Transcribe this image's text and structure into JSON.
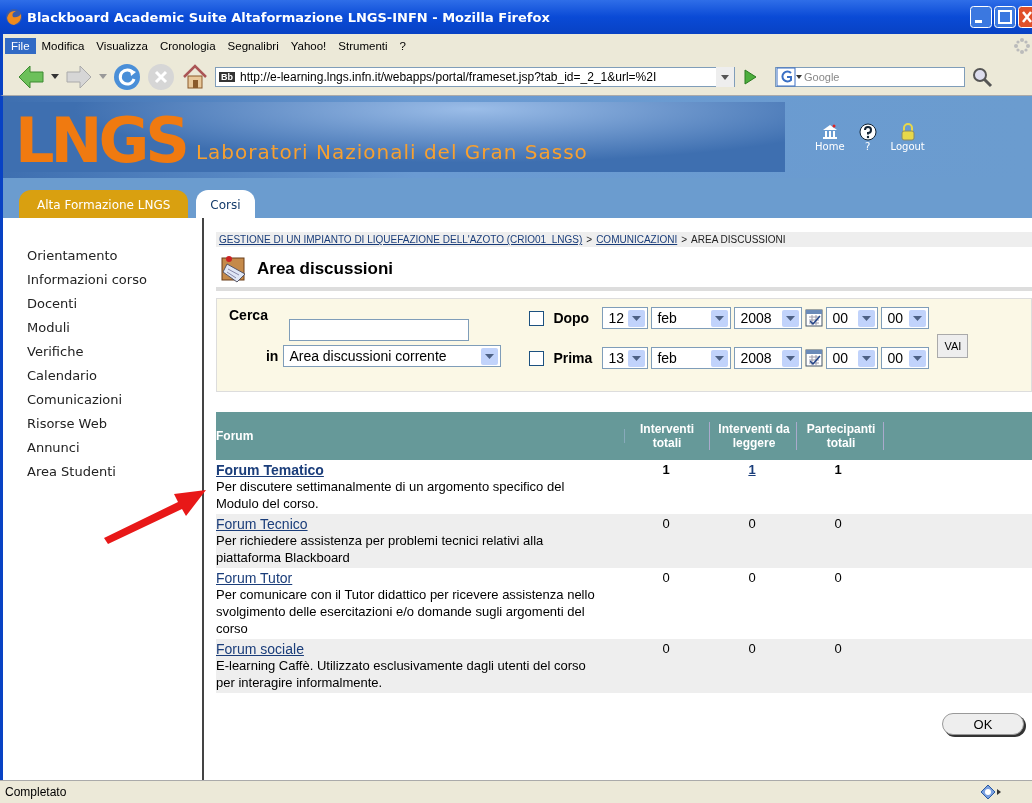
{
  "window": {
    "title": "Blackboard Academic Suite Altaformazione LNGS-INFN - Mozilla Firefox"
  },
  "menu": [
    {
      "label": "File",
      "highlighted": true
    },
    {
      "label": "Modifica",
      "highlighted": false
    },
    {
      "label": "Visualizza",
      "highlighted": false
    },
    {
      "label": "Cronologia",
      "highlighted": false
    },
    {
      "label": "Segnalibri",
      "highlighted": false
    },
    {
      "label": "Yahoo!",
      "highlighted": false
    },
    {
      "label": "Strumenti",
      "highlighted": false
    },
    {
      "label": "?",
      "highlighted": false
    }
  ],
  "toolbar": {
    "address": "http://e-learning.lngs.infn.it/webapps/portal/frameset.jsp?tab_id=_2_1&url=%2I",
    "site_badge": "Bb",
    "search_placeholder": "Google"
  },
  "banner": {
    "logo": "LNGS",
    "subtitle": "Laboratori Nazionali del Gran Sasso",
    "links": [
      {
        "kind": "home",
        "label": "Home"
      },
      {
        "kind": "help",
        "label": "?"
      },
      {
        "kind": "logout",
        "label": "Logout"
      }
    ]
  },
  "tabs": [
    {
      "label": "Alta Formazione LNGS",
      "selected": false
    },
    {
      "label": "Corsi",
      "selected": true
    }
  ],
  "sidebar": {
    "items": [
      "Orientamento",
      "Informazioni corso",
      "Docenti",
      "Moduli",
      "Verifiche",
      "Calendario",
      "Comunicazioni",
      "Risorse Web",
      "Annunci",
      "Area Studenti"
    ]
  },
  "breadcrumb": {
    "items": [
      {
        "kind": "link",
        "text": "GESTIONE DI UN IMPIANTO DI LIQUEFAZIONE DELL'AZOTO (CRIO01_LNGS)"
      },
      {
        "kind": "separator",
        "text": ">"
      },
      {
        "kind": "link",
        "text": "COMUNICAZIONI"
      },
      {
        "kind": "separator",
        "text": ">"
      },
      {
        "kind": "current",
        "text": "AREA DISCUSSIONI"
      }
    ]
  },
  "page_title": "Area discussioni",
  "search": {
    "label": "Cerca",
    "in_label": "in",
    "scope": "Area discussioni corrente",
    "submit": "VAI",
    "filters": [
      {
        "label": "Dopo",
        "checked": false,
        "day": "12",
        "month": "feb",
        "year": "2008",
        "hour": "00",
        "minute": "00"
      },
      {
        "label": "Prima",
        "checked": false,
        "day": "13",
        "month": "feb",
        "year": "2008",
        "hour": "00",
        "minute": "00"
      }
    ]
  },
  "table": {
    "columns": [
      "Forum",
      "Interventi totali",
      "Interventi da leggere",
      "Partecipanti totali"
    ],
    "rows": [
      {
        "name": "Forum Tematico",
        "description": "Per discutere settimanalmente di un argomento specifico del Modulo del corso.",
        "total": "1",
        "unread": "1",
        "participants": "1",
        "bold": true,
        "unread_link": true
      },
      {
        "name": "Forum Tecnico",
        "description": "Per richiedere assistenza per problemi tecnici relativi alla piattaforma Blackboard",
        "total": "0",
        "unread": "0",
        "participants": "0",
        "bold": false,
        "unread_link": false
      },
      {
        "name": "Forum Tutor",
        "description": "Per comunicare con il Tutor didattico per ricevere assistenza nello svolgimento delle esercitazioni e/o domande sugli argomenti del corso",
        "total": "0",
        "unread": "0",
        "participants": "0",
        "bold": false,
        "unread_link": false
      },
      {
        "name": "Forum sociale",
        "description": "E-learning Caffè. Utilizzato esclusivamente dagli utenti del corso per interagire informalmente.",
        "total": "0",
        "unread": "0",
        "participants": "0",
        "bold": false,
        "unread_link": false
      }
    ]
  },
  "ok_button": "OK",
  "status_bar": {
    "text": "Completato"
  }
}
